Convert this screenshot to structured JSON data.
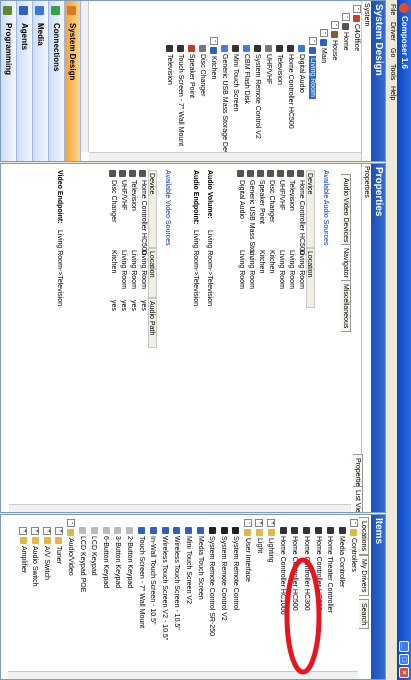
{
  "app": {
    "title": "Composer 1.6"
  },
  "menu": [
    "File",
    "Driver",
    "Go",
    "Tools",
    "Help"
  ],
  "left": {
    "title": "System Design",
    "subtitle": "System",
    "tree": [
      {
        "label": "C4Office",
        "d": 0,
        "exp": "-",
        "color": "#d23c2c"
      },
      {
        "label": "Home",
        "d": 1,
        "exp": "-",
        "color": "#555555"
      },
      {
        "label": "House",
        "d": 2,
        "exp": "-",
        "color": "#8a5a2a"
      },
      {
        "label": "Main",
        "d": 3,
        "exp": "-",
        "color": "#2f5fbf"
      },
      {
        "label": "Living Room",
        "d": 4,
        "exp": "-",
        "color": "#2f5fbf",
        "sel": true
      },
      {
        "label": "Digital Audio",
        "d": 5,
        "color": "#3a78d6"
      },
      {
        "label": "Home Controller HC500",
        "d": 5,
        "color": "#333333"
      },
      {
        "label": "Television",
        "d": 5,
        "color": "#333333"
      },
      {
        "label": "UHF/VHF",
        "d": 5,
        "color": "#777777"
      },
      {
        "label": "System Remote Control V2",
        "d": 5,
        "color": "#333333"
      },
      {
        "label": "CBM Flash Disk",
        "d": 5,
        "color": "#4a7bd6"
      },
      {
        "label": "Mini Touch Screen",
        "d": 5,
        "color": "#333333"
      },
      {
        "label": "Generic USB Mass Storage Device",
        "d": 5,
        "color": "#4a7bd6"
      },
      {
        "label": "Kitchen",
        "d": 4,
        "exp": "-",
        "color": "#2f5fbf"
      },
      {
        "label": "Disc Changer",
        "d": 5,
        "color": "#777777"
      },
      {
        "label": "Speaker Point",
        "d": 5,
        "color": "#c0392b"
      },
      {
        "label": "Touch Screen - 7\" Wall Mount",
        "d": 5,
        "color": "#333333"
      },
      {
        "label": "Television",
        "d": 5,
        "color": "#333333"
      }
    ],
    "nav": [
      {
        "label": "System Design",
        "color": "#d9782a",
        "active": true
      },
      {
        "label": "Connections",
        "color": "#3aa04a"
      },
      {
        "label": "Media",
        "color": "#3a78d6"
      },
      {
        "label": "Agents",
        "color": "#2f5fbf"
      },
      {
        "label": "Programming",
        "color": "#5a8a2a"
      }
    ]
  },
  "center": {
    "title": "Properties",
    "subtitle": "Properties",
    "view_tabs": [
      "Properties",
      "List View"
    ],
    "tabs": [
      "Audio Video Devices",
      "Navigator",
      "Miscellaneous"
    ],
    "audio": {
      "heading": "Available Audio Sources",
      "columns": [
        "Device",
        "Location"
      ],
      "rows": [
        {
          "device": "Home Controller HC500",
          "location": "Living Room"
        },
        {
          "device": "Television",
          "location": "Living Room"
        },
        {
          "device": "UHF/VHF",
          "location": "Living Room"
        },
        {
          "device": "Disc Changer",
          "location": "Kitchen"
        },
        {
          "device": "Speaker Point",
          "location": "Kitchen"
        },
        {
          "device": "Generic USB Mass Stor...",
          "location": "Living Room"
        },
        {
          "device": "Digital Audio",
          "location": "Living Room"
        }
      ],
      "volume_label": "Audio Volume:",
      "volume_value": "Living Room->Television",
      "endpoint_label": "Audio Endpoint:",
      "endpoint_value": "Living Room->Television"
    },
    "video": {
      "heading": "Available Video Sources",
      "columns": [
        "Device",
        "Location",
        "Audio Path"
      ],
      "rows": [
        {
          "device": "Home Controller HC500",
          "location": "Living Room",
          "path": "yes"
        },
        {
          "device": "Television",
          "location": "Living Room",
          "path": "yes"
        },
        {
          "device": "UHF/VHF",
          "location": "Living Room",
          "path": "yes"
        },
        {
          "device": "Disc Changer",
          "location": "Kitchen",
          "path": "yes"
        }
      ],
      "endpoint_label": "Video Endpoint:",
      "endpoint_value": "Living Room->Television"
    }
  },
  "right": {
    "title": "Items",
    "tabs": [
      "Locations",
      "My Drivers",
      "Search"
    ],
    "tree": [
      {
        "label": "Controllers",
        "d": 0,
        "exp": "-",
        "color": "#e0b84a"
      },
      {
        "label": "Media Controller",
        "d": 1,
        "color": "#333333"
      },
      {
        "label": "Home Theater Controller",
        "d": 1,
        "color": "#333333"
      },
      {
        "label": "Home Controller HC200",
        "d": 1,
        "color": "#333333"
      },
      {
        "label": "Home Controller HC300",
        "d": 1,
        "color": "#333333"
      },
      {
        "label": "Home Controller HC500",
        "d": 1,
        "color": "#333333"
      },
      {
        "label": "Home Controller HC1000",
        "d": 1,
        "color": "#333333"
      },
      {
        "label": "Lighting",
        "d": 0,
        "exp": "+",
        "color": "#e0b84a"
      },
      {
        "label": "Light",
        "d": 0,
        "exp": "+",
        "color": "#e0b84a"
      },
      {
        "label": "User Interface",
        "d": 0,
        "exp": "-",
        "color": "#e0b84a"
      },
      {
        "label": "System Remote Control",
        "d": 1,
        "color": "#222222"
      },
      {
        "label": "System Remote Control V2",
        "d": 1,
        "color": "#222222"
      },
      {
        "label": "System Remote Control SR-250",
        "d": 1,
        "color": "#222222"
      },
      {
        "label": "Media Touch Screen",
        "d": 1,
        "color": "#2f5fbf"
      },
      {
        "label": "Mini Touch Screen V2",
        "d": 1,
        "color": "#2f5fbf"
      },
      {
        "label": "Wireless Touch Screen - 10.5\"",
        "d": 1,
        "color": "#2f5fbf"
      },
      {
        "label": "Wireless Touch Screen V2 - 10.5\"",
        "d": 1,
        "color": "#2f5fbf"
      },
      {
        "label": "In-Wall Touch Screen - 10.5\"",
        "d": 1,
        "color": "#2f5fbf"
      },
      {
        "label": "Touch Screen - 7\" Wall Mount",
        "d": 1,
        "color": "#2f5fbf"
      },
      {
        "label": "2-Button Keypad",
        "d": 1,
        "color": "#bbbbbb"
      },
      {
        "label": "3-Button Keypad",
        "d": 1,
        "color": "#bbbbbb"
      },
      {
        "label": "6-Button Keypad",
        "d": 1,
        "color": "#bbbbbb"
      },
      {
        "label": "LCD Keypad",
        "d": 1,
        "color": "#bbbbbb"
      },
      {
        "label": "LCD Keypad POE",
        "d": 1,
        "color": "#bbbbbb"
      },
      {
        "label": "Audio/Video",
        "d": 0,
        "exp": "-",
        "color": "#e0b84a"
      },
      {
        "label": "Tuner",
        "d": 1,
        "exp": "+",
        "color": "#e0b84a"
      },
      {
        "label": "A/V Switch",
        "d": 1,
        "exp": "+",
        "color": "#e0b84a"
      },
      {
        "label": "Audio Switch",
        "d": 1,
        "exp": "+",
        "color": "#e0b84a"
      },
      {
        "label": "Amplifier",
        "d": 1,
        "exp": "+",
        "color": "#e0b84a"
      }
    ]
  },
  "annotation": {
    "color": "#e8141e"
  }
}
